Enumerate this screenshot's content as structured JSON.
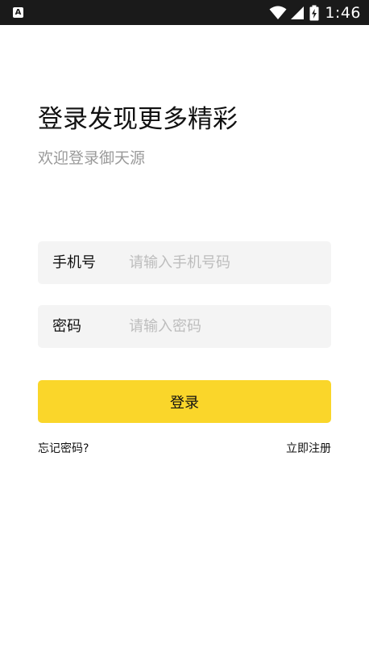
{
  "status_bar": {
    "app_icon_letter": "A",
    "icons": [
      "wifi-icon",
      "signal-icon",
      "battery-charging-icon"
    ],
    "time": "1:46",
    "background": "#1a1a1a"
  },
  "login": {
    "title": "登录发现更多精彩",
    "subtitle": "欢迎登录御天源",
    "phone": {
      "label": "手机号",
      "placeholder": "请输入手机号码",
      "value": ""
    },
    "password": {
      "label": "密码",
      "placeholder": "请输入密码",
      "value": ""
    },
    "submit_label": "登录",
    "forgot_password": "忘记密码?",
    "register": "立即注册"
  },
  "colors": {
    "accent": "#fad62a",
    "field_background": "#f4f4f4",
    "subtitle_text": "#9a9a9a",
    "placeholder_text": "#bdbdbd"
  }
}
